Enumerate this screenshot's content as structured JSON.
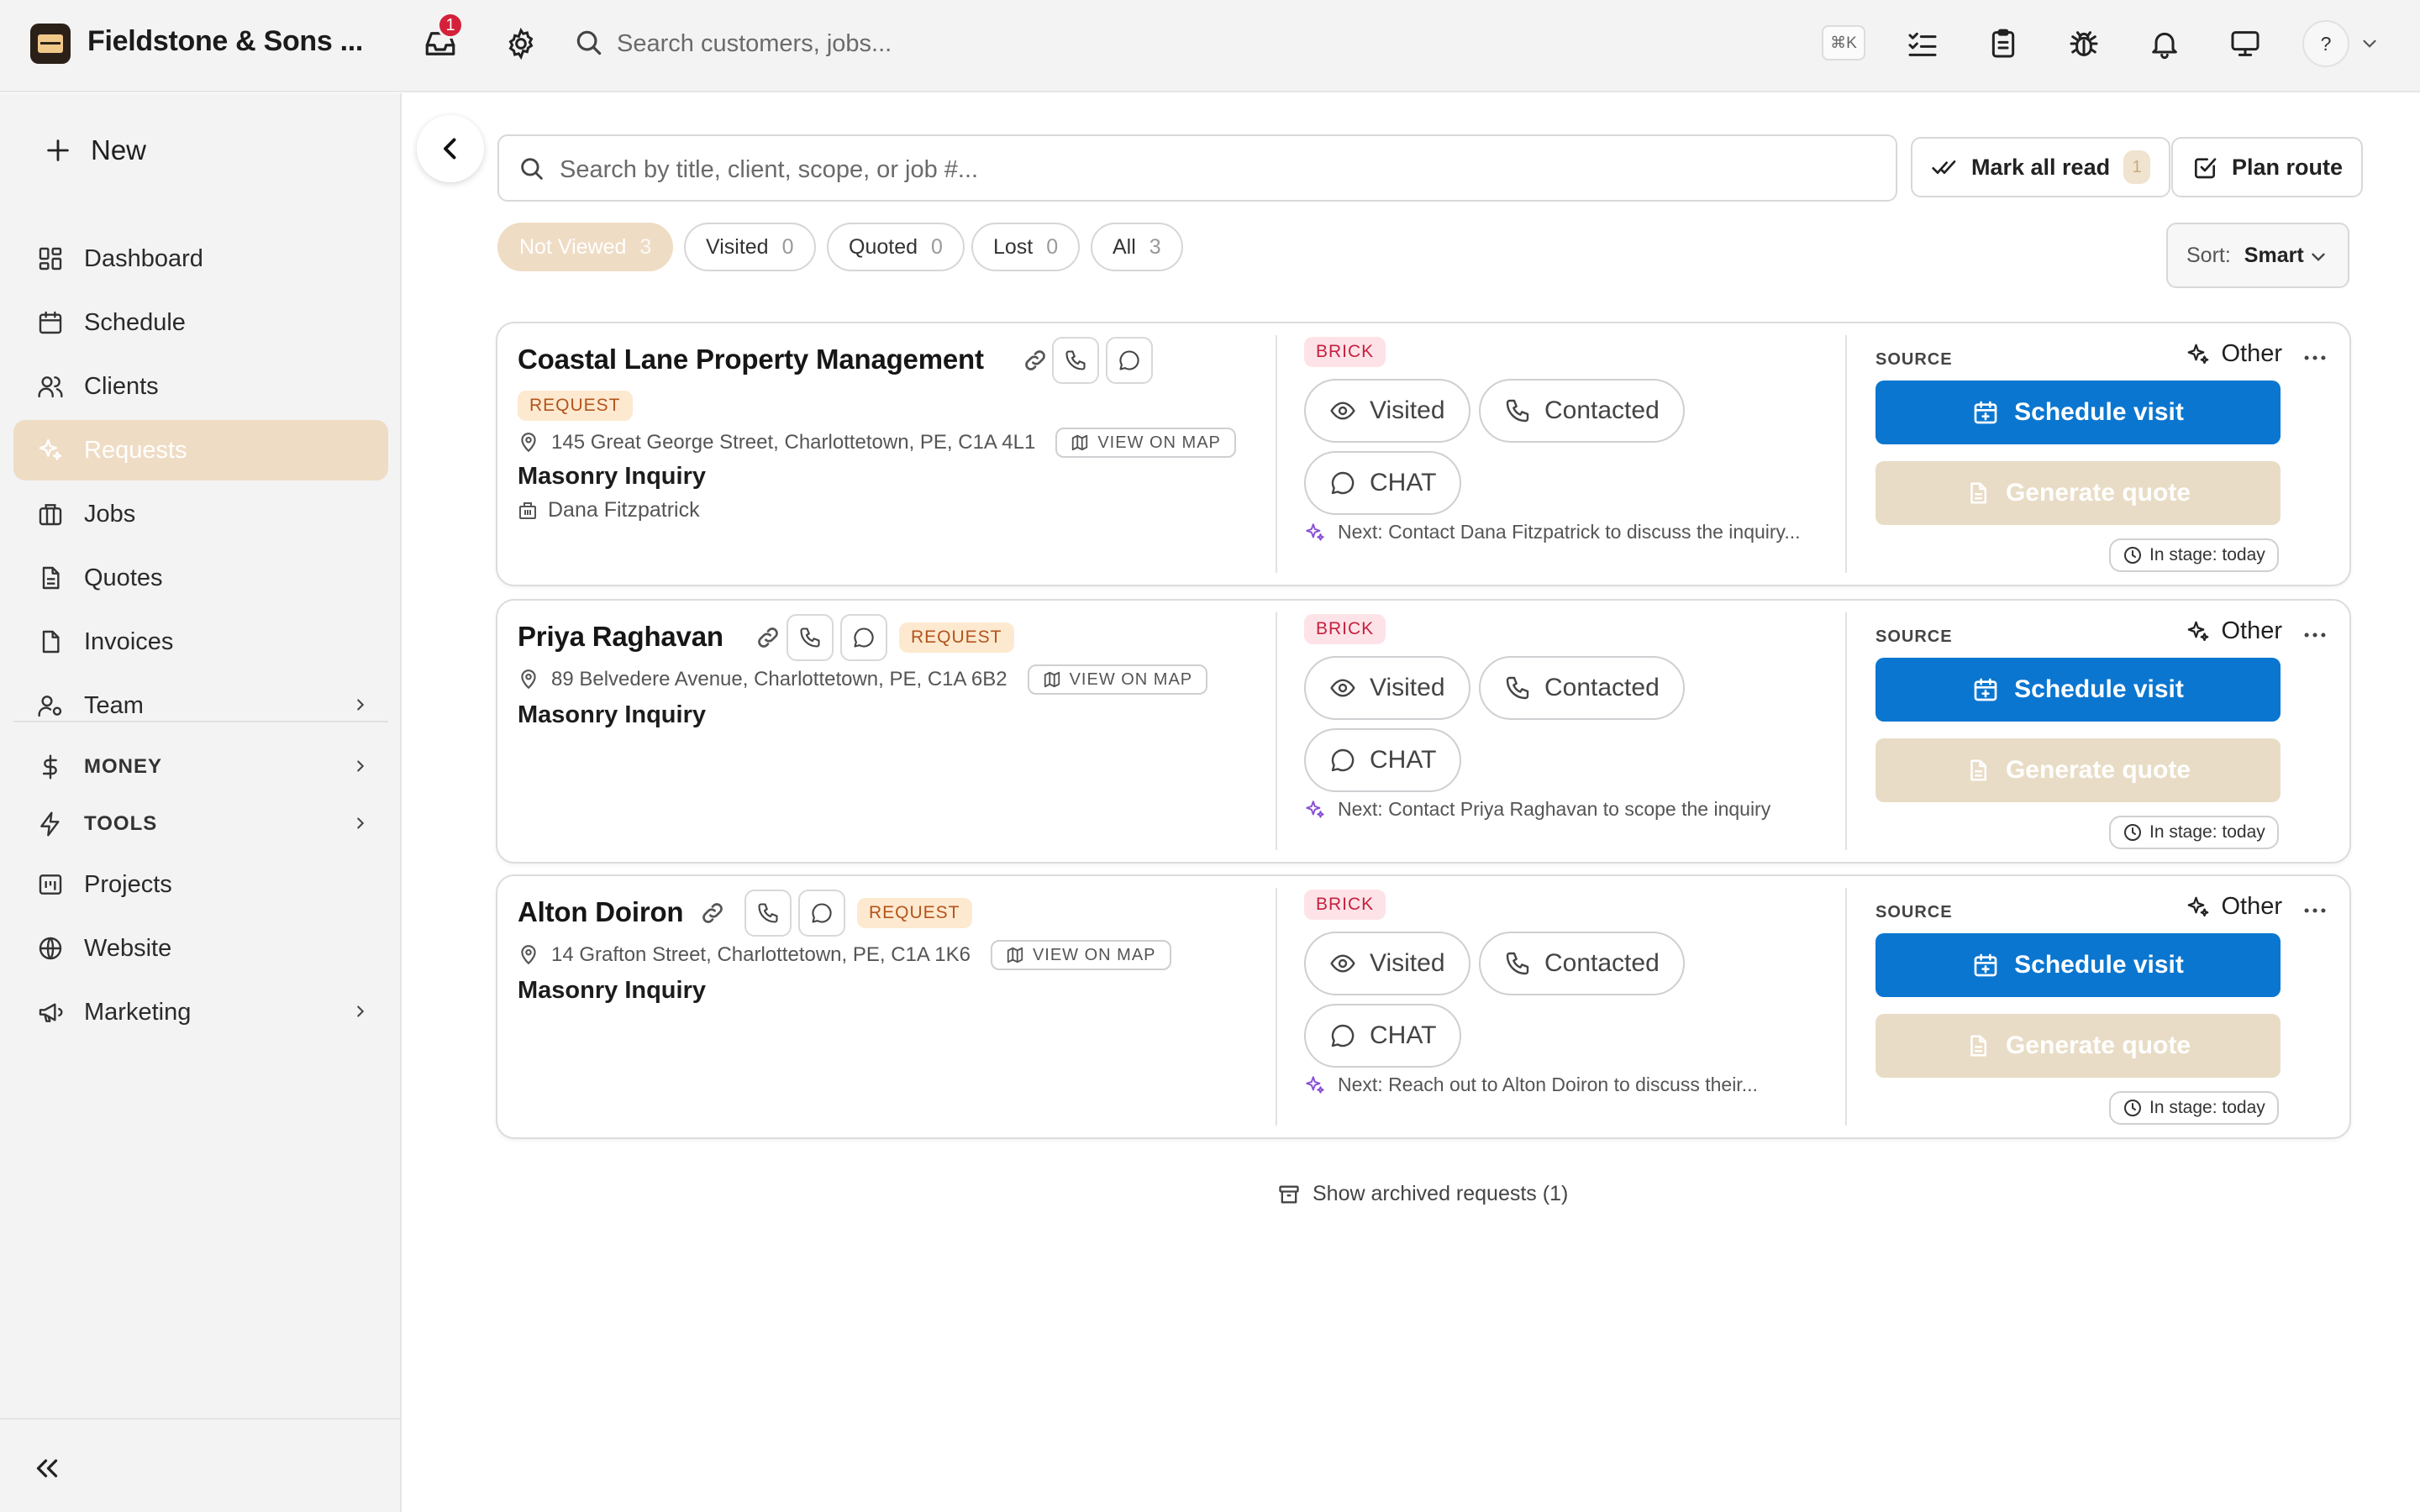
{
  "app": {
    "title": "Fieldstone & Sons ...",
    "inbox_badge": "1",
    "search_placeholder": "Search customers, jobs...",
    "search_shortcut": "⌘K",
    "help_label": "?"
  },
  "sidebar": {
    "new_label": "New",
    "items": [
      {
        "label": "Dashboard",
        "icon": "dashboard-icon"
      },
      {
        "label": "Schedule",
        "icon": "calendar-icon"
      },
      {
        "label": "Clients",
        "icon": "users-icon"
      },
      {
        "label": "Requests",
        "icon": "sparkle-icon",
        "active": true
      },
      {
        "label": "Jobs",
        "icon": "briefcase-icon"
      },
      {
        "label": "Quotes",
        "icon": "document-icon"
      },
      {
        "label": "Invoices",
        "icon": "invoice-icon"
      },
      {
        "label": "Team",
        "icon": "team-icon"
      }
    ],
    "sections": [
      {
        "label": "MONEY",
        "icon": "dollar-icon"
      },
      {
        "label": "TOOLS",
        "icon": "bolt-icon"
      }
    ],
    "bottom_items": [
      {
        "label": "Projects",
        "icon": "projects-icon"
      },
      {
        "label": "Website",
        "icon": "globe-icon"
      },
      {
        "label": "Marketing",
        "icon": "megaphone-icon"
      }
    ]
  },
  "requests": {
    "search_placeholder": "Search by title, client, scope, or job #...",
    "mark_all_read": "Mark all read",
    "mark_all_read_count": "1",
    "plan_route": "Plan route",
    "filters": [
      {
        "label": "Not Viewed",
        "count": "3",
        "active": true
      },
      {
        "label": "Visited",
        "count": "0"
      },
      {
        "label": "Quoted",
        "count": "0"
      },
      {
        "label": "Lost",
        "count": "0"
      },
      {
        "label": "All",
        "count": "3"
      }
    ],
    "sort_label": "Sort:",
    "sort_value": "Smart",
    "cards": [
      {
        "client": "Coastal Lane Property Management",
        "tag": "REQUEST",
        "address": "145 Great George Street, Charlottetown, PE, C1A 4L1",
        "map_label": "VIEW ON MAP",
        "title": "Masonry Inquiry",
        "contact": "Dana Fitzpatrick",
        "trade": "BRICK",
        "visited": "Visited",
        "contacted": "Contacted",
        "chat": "CHAT",
        "next": "Next: Contact Dana Fitzpatrick to discuss the inquiry...",
        "source_label": "SOURCE",
        "source": "Other",
        "schedule": "Schedule visit",
        "quote": "Generate quote",
        "stage": "In stage: today"
      },
      {
        "client": "Priya Raghavan",
        "tag": "REQUEST",
        "address": "89 Belvedere Avenue, Charlottetown, PE, C1A 6B2",
        "map_label": "VIEW ON MAP",
        "title": "Masonry Inquiry",
        "trade": "BRICK",
        "visited": "Visited",
        "contacted": "Contacted",
        "chat": "CHAT",
        "next": "Next: Contact Priya Raghavan to scope the inquiry",
        "source_label": "SOURCE",
        "source": "Other",
        "schedule": "Schedule visit",
        "quote": "Generate quote",
        "stage": "In stage: today"
      },
      {
        "client": "Alton Doiron",
        "tag": "REQUEST",
        "address": "14 Grafton Street, Charlottetown, PE, C1A 1K6",
        "map_label": "VIEW ON MAP",
        "title": "Masonry Inquiry",
        "trade": "BRICK",
        "visited": "Visited",
        "contacted": "Contacted",
        "chat": "CHAT",
        "next": "Next: Reach out to Alton Doiron to discuss their...",
        "source_label": "SOURCE",
        "source": "Other",
        "schedule": "Schedule visit",
        "quote": "Generate quote",
        "stage": "In stage: today"
      }
    ],
    "archived_label": "Show archived requests (1)"
  },
  "colors": {
    "accent_blue": "#0a76d0",
    "active_nav": "#efdcc4",
    "badge_red": "#d5203a",
    "request_tag": "#fde9cf",
    "brick_tag": "#fde3e8"
  }
}
